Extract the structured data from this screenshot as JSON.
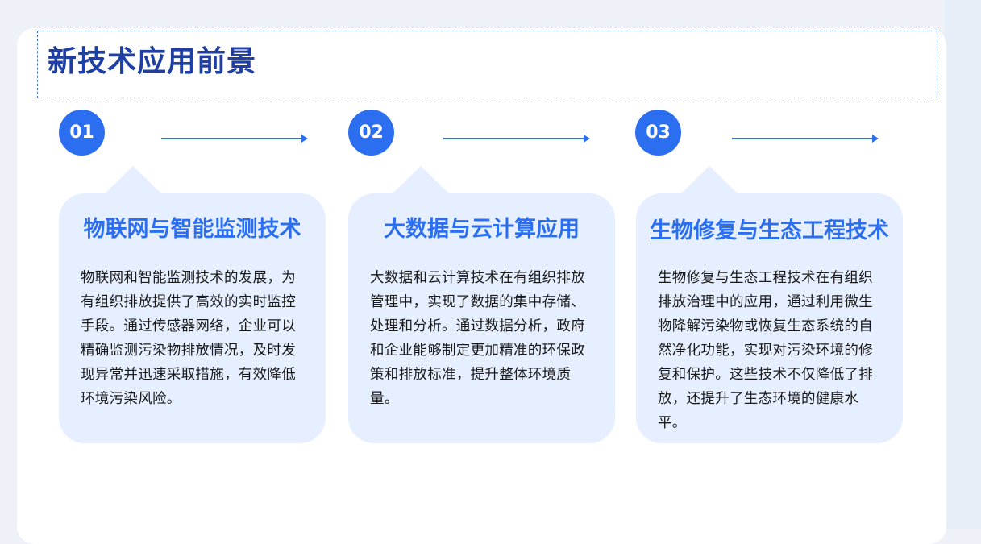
{
  "title": "新技术应用前景",
  "colors": {
    "accent": "#2b6ff0",
    "title": "#1f3fa3",
    "card_bg": "#e6efff"
  },
  "steps": [
    {
      "number": "01",
      "heading": "物联网与智能监测技术",
      "body": "物联网和智能监测技术的发展，为有组织排放提供了高效的实时监控手段。通过传感器网络，企业可以精确监测污染物排放情况，及时发现异常并迅速采取措施，有效降低环境污染风险。"
    },
    {
      "number": "02",
      "heading": "大数据与云计算应用",
      "body": "大数据和云计算技术在有组织排放管理中，实现了数据的集中存储、处理和分析。通过数据分析，政府和企业能够制定更加精准的环保政策和排放标准，提升整体环境质量。"
    },
    {
      "number": "03",
      "heading": "生物修复与生态工程技术",
      "body": "生物修复与生态工程技术在有组织排放治理中的应用，通过利用微生物降解污染物或恢复生态系统的自然净化功能，实现对污染环境的修复和保护。这些技术不仅降低了排放，还提升了生态环境的健康水平。"
    }
  ]
}
